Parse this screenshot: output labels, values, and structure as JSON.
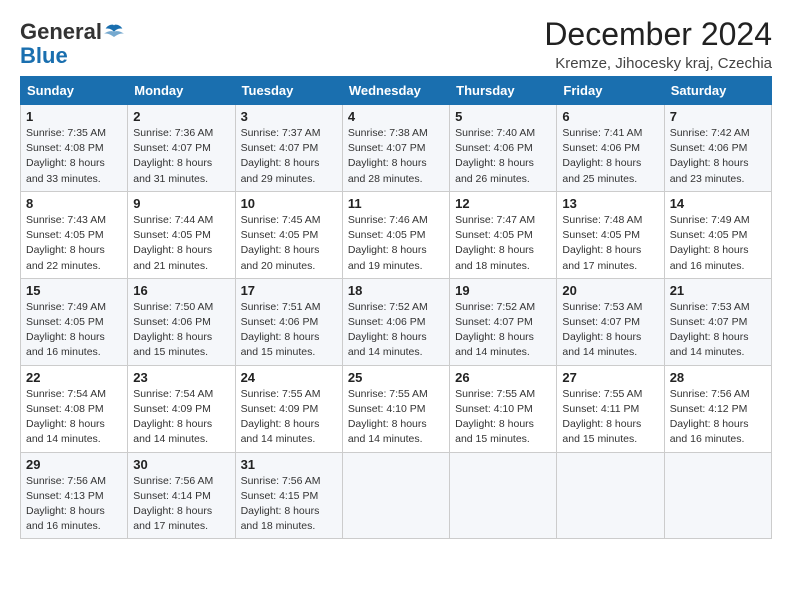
{
  "logo": {
    "general": "General",
    "blue": "Blue"
  },
  "title": "December 2024",
  "subtitle": "Kremze, Jihocesky kraj, Czechia",
  "header": {
    "days": [
      "Sunday",
      "Monday",
      "Tuesday",
      "Wednesday",
      "Thursday",
      "Friday",
      "Saturday"
    ]
  },
  "weeks": [
    [
      {
        "day": "1",
        "sunrise": "Sunrise: 7:35 AM",
        "sunset": "Sunset: 4:08 PM",
        "daylight": "Daylight: 8 hours and 33 minutes."
      },
      {
        "day": "2",
        "sunrise": "Sunrise: 7:36 AM",
        "sunset": "Sunset: 4:07 PM",
        "daylight": "Daylight: 8 hours and 31 minutes."
      },
      {
        "day": "3",
        "sunrise": "Sunrise: 7:37 AM",
        "sunset": "Sunset: 4:07 PM",
        "daylight": "Daylight: 8 hours and 29 minutes."
      },
      {
        "day": "4",
        "sunrise": "Sunrise: 7:38 AM",
        "sunset": "Sunset: 4:07 PM",
        "daylight": "Daylight: 8 hours and 28 minutes."
      },
      {
        "day": "5",
        "sunrise": "Sunrise: 7:40 AM",
        "sunset": "Sunset: 4:06 PM",
        "daylight": "Daylight: 8 hours and 26 minutes."
      },
      {
        "day": "6",
        "sunrise": "Sunrise: 7:41 AM",
        "sunset": "Sunset: 4:06 PM",
        "daylight": "Daylight: 8 hours and 25 minutes."
      },
      {
        "day": "7",
        "sunrise": "Sunrise: 7:42 AM",
        "sunset": "Sunset: 4:06 PM",
        "daylight": "Daylight: 8 hours and 23 minutes."
      }
    ],
    [
      {
        "day": "8",
        "sunrise": "Sunrise: 7:43 AM",
        "sunset": "Sunset: 4:05 PM",
        "daylight": "Daylight: 8 hours and 22 minutes."
      },
      {
        "day": "9",
        "sunrise": "Sunrise: 7:44 AM",
        "sunset": "Sunset: 4:05 PM",
        "daylight": "Daylight: 8 hours and 21 minutes."
      },
      {
        "day": "10",
        "sunrise": "Sunrise: 7:45 AM",
        "sunset": "Sunset: 4:05 PM",
        "daylight": "Daylight: 8 hours and 20 minutes."
      },
      {
        "day": "11",
        "sunrise": "Sunrise: 7:46 AM",
        "sunset": "Sunset: 4:05 PM",
        "daylight": "Daylight: 8 hours and 19 minutes."
      },
      {
        "day": "12",
        "sunrise": "Sunrise: 7:47 AM",
        "sunset": "Sunset: 4:05 PM",
        "daylight": "Daylight: 8 hours and 18 minutes."
      },
      {
        "day": "13",
        "sunrise": "Sunrise: 7:48 AM",
        "sunset": "Sunset: 4:05 PM",
        "daylight": "Daylight: 8 hours and 17 minutes."
      },
      {
        "day": "14",
        "sunrise": "Sunrise: 7:49 AM",
        "sunset": "Sunset: 4:05 PM",
        "daylight": "Daylight: 8 hours and 16 minutes."
      }
    ],
    [
      {
        "day": "15",
        "sunrise": "Sunrise: 7:49 AM",
        "sunset": "Sunset: 4:05 PM",
        "daylight": "Daylight: 8 hours and 16 minutes."
      },
      {
        "day": "16",
        "sunrise": "Sunrise: 7:50 AM",
        "sunset": "Sunset: 4:06 PM",
        "daylight": "Daylight: 8 hours and 15 minutes."
      },
      {
        "day": "17",
        "sunrise": "Sunrise: 7:51 AM",
        "sunset": "Sunset: 4:06 PM",
        "daylight": "Daylight: 8 hours and 15 minutes."
      },
      {
        "day": "18",
        "sunrise": "Sunrise: 7:52 AM",
        "sunset": "Sunset: 4:06 PM",
        "daylight": "Daylight: 8 hours and 14 minutes."
      },
      {
        "day": "19",
        "sunrise": "Sunrise: 7:52 AM",
        "sunset": "Sunset: 4:07 PM",
        "daylight": "Daylight: 8 hours and 14 minutes."
      },
      {
        "day": "20",
        "sunrise": "Sunrise: 7:53 AM",
        "sunset": "Sunset: 4:07 PM",
        "daylight": "Daylight: 8 hours and 14 minutes."
      },
      {
        "day": "21",
        "sunrise": "Sunrise: 7:53 AM",
        "sunset": "Sunset: 4:07 PM",
        "daylight": "Daylight: 8 hours and 14 minutes."
      }
    ],
    [
      {
        "day": "22",
        "sunrise": "Sunrise: 7:54 AM",
        "sunset": "Sunset: 4:08 PM",
        "daylight": "Daylight: 8 hours and 14 minutes."
      },
      {
        "day": "23",
        "sunrise": "Sunrise: 7:54 AM",
        "sunset": "Sunset: 4:09 PM",
        "daylight": "Daylight: 8 hours and 14 minutes."
      },
      {
        "day": "24",
        "sunrise": "Sunrise: 7:55 AM",
        "sunset": "Sunset: 4:09 PM",
        "daylight": "Daylight: 8 hours and 14 minutes."
      },
      {
        "day": "25",
        "sunrise": "Sunrise: 7:55 AM",
        "sunset": "Sunset: 4:10 PM",
        "daylight": "Daylight: 8 hours and 14 minutes."
      },
      {
        "day": "26",
        "sunrise": "Sunrise: 7:55 AM",
        "sunset": "Sunset: 4:10 PM",
        "daylight": "Daylight: 8 hours and 15 minutes."
      },
      {
        "day": "27",
        "sunrise": "Sunrise: 7:55 AM",
        "sunset": "Sunset: 4:11 PM",
        "daylight": "Daylight: 8 hours and 15 minutes."
      },
      {
        "day": "28",
        "sunrise": "Sunrise: 7:56 AM",
        "sunset": "Sunset: 4:12 PM",
        "daylight": "Daylight: 8 hours and 16 minutes."
      }
    ],
    [
      {
        "day": "29",
        "sunrise": "Sunrise: 7:56 AM",
        "sunset": "Sunset: 4:13 PM",
        "daylight": "Daylight: 8 hours and 16 minutes."
      },
      {
        "day": "30",
        "sunrise": "Sunrise: 7:56 AM",
        "sunset": "Sunset: 4:14 PM",
        "daylight": "Daylight: 8 hours and 17 minutes."
      },
      {
        "day": "31",
        "sunrise": "Sunrise: 7:56 AM",
        "sunset": "Sunset: 4:15 PM",
        "daylight": "Daylight: 8 hours and 18 minutes."
      },
      null,
      null,
      null,
      null
    ]
  ]
}
